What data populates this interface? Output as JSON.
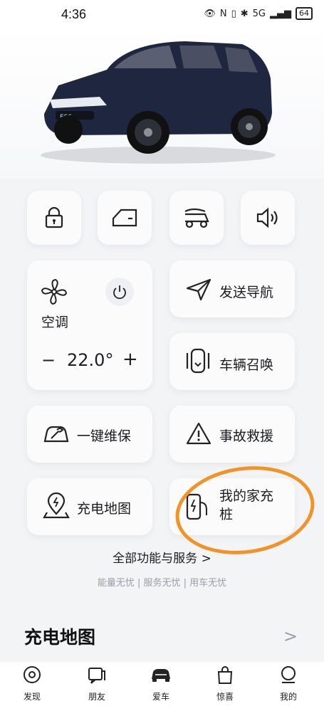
{
  "status_bar": {
    "time": "4:36",
    "battery": "64",
    "network": "5G",
    "signal_text": "il"
  },
  "car": {
    "badge": "ES6"
  },
  "quick_controls": [
    "lock-icon",
    "door-icon",
    "trunk-icon",
    "speaker-icon"
  ],
  "ac": {
    "label": "空调",
    "minus": "−",
    "temperature": "22.0°",
    "plus": "+"
  },
  "features": {
    "send_navigation": "发送导航",
    "summon": "车辆召唤",
    "maintenance": "一键维保",
    "rescue": "事故救援",
    "charging_map": "充电地图",
    "home_charger": "我的家充桩"
  },
  "all_functions": "全部功能与服务 >",
  "tagline": "能量无忧 | 服务无忧 | 用车无忧",
  "section": {
    "title": "充电地图",
    "arrow": ">"
  },
  "tabs": [
    {
      "label": "发现"
    },
    {
      "label": "朋友"
    },
    {
      "label": "爱车"
    },
    {
      "label": "惊喜"
    },
    {
      "label": "我的"
    }
  ],
  "colors": {
    "highlight": "#f0942a",
    "background": "#f3f4f6",
    "card": "#fbfbfc",
    "car_body": "#1f2640"
  }
}
